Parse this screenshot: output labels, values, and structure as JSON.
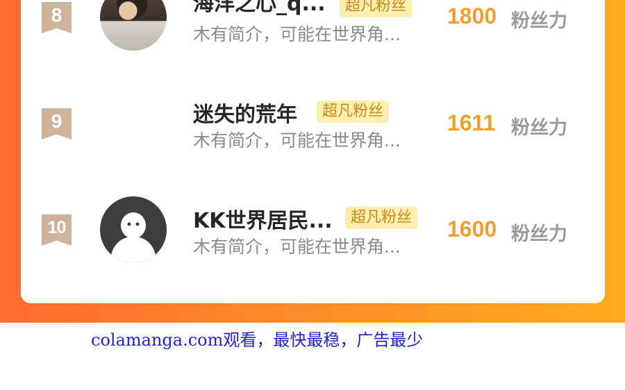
{
  "ranking": {
    "rows": [
      {
        "rank": "8",
        "name": "海洋之心_q...",
        "tag": "超凡粉丝",
        "desc": "木有简介，可能在世界角...",
        "score": "1800",
        "unit": "粉丝力",
        "avatar": "photo"
      },
      {
        "rank": "9",
        "name": "迷失的荒年",
        "tag": "超凡粉丝",
        "desc": "木有简介，可能在世界角...",
        "score": "1611",
        "unit": "粉丝力",
        "avatar": "none"
      },
      {
        "rank": "10",
        "name": "KK世界居民...",
        "tag": "超凡粉丝",
        "desc": "木有简介，可能在世界角...",
        "score": "1600",
        "unit": "粉丝力",
        "avatar": "default-ghost-icon"
      }
    ]
  },
  "watermark": "colamanga.com观看，最快最稳，广告最少",
  "colors": {
    "banner_left": "#ff6a2f",
    "banner_right": "#ffaa1e",
    "score": "#f0a02a",
    "tag_bg": "#fdeeb0",
    "tag_text": "#c98a1a",
    "rank_badge": "#cdb39c"
  }
}
